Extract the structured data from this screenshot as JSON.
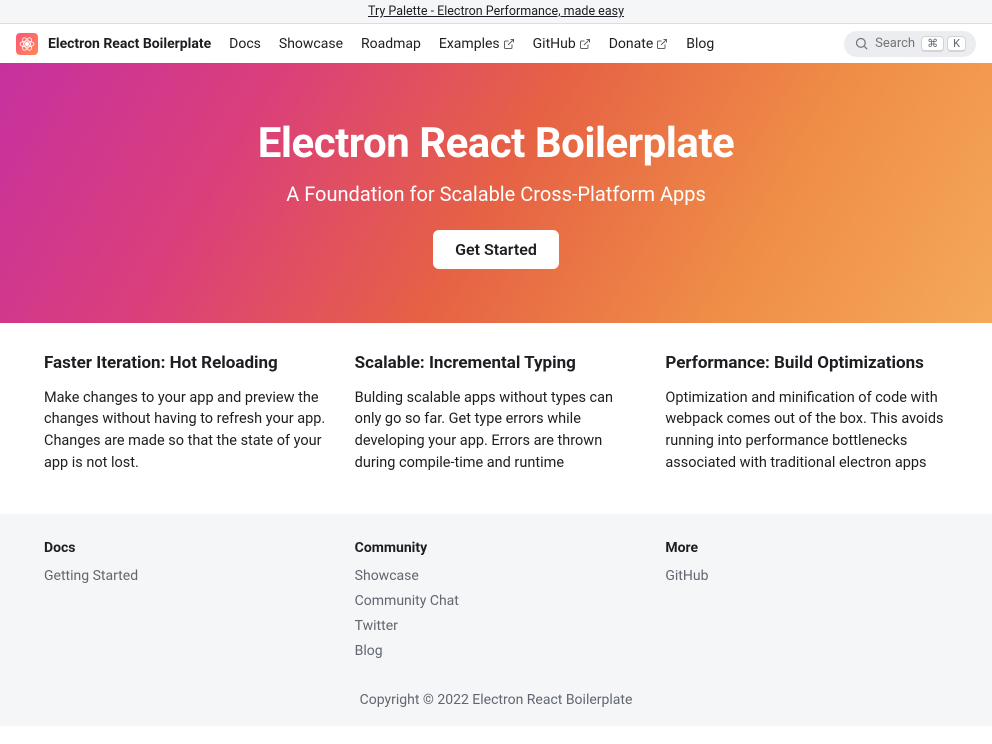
{
  "announcement": {
    "text": "Try Palette - Electron Performance, made easy"
  },
  "navbar": {
    "brand": "Electron React Boilerplate",
    "links": [
      {
        "label": "Docs",
        "external": false
      },
      {
        "label": "Showcase",
        "external": false
      },
      {
        "label": "Roadmap",
        "external": false
      },
      {
        "label": "Examples",
        "external": true
      },
      {
        "label": "GitHub",
        "external": true
      },
      {
        "label": "Donate",
        "external": true
      },
      {
        "label": "Blog",
        "external": false
      }
    ],
    "search": {
      "placeholder": "Search",
      "shortcut": [
        "⌘",
        "K"
      ]
    }
  },
  "hero": {
    "title": "Electron React Boilerplate",
    "subtitle": "A Foundation for Scalable Cross-Platform Apps",
    "cta": "Get Started"
  },
  "features": [
    {
      "title": "Faster Iteration: Hot Reloading",
      "body": "Make changes to your app and preview the changes without having to refresh your app. Changes are made so that the state of your app is not lost."
    },
    {
      "title": "Scalable: Incremental Typing",
      "body": "Bulding scalable apps without types can only go so far. Get type errors while developing your app. Errors are thrown during compile-time and runtime"
    },
    {
      "title": "Performance: Build Optimizations",
      "body": "Optimization and minification of code with webpack comes out of the box. This avoids running into performance bottlenecks associated with traditional electron apps"
    }
  ],
  "footer": {
    "columns": [
      {
        "heading": "Docs",
        "items": [
          "Getting Started"
        ]
      },
      {
        "heading": "Community",
        "items": [
          "Showcase",
          "Community Chat",
          "Twitter",
          "Blog"
        ]
      },
      {
        "heading": "More",
        "items": [
          "GitHub"
        ]
      }
    ],
    "copyright": "Copyright © 2022 Electron React Boilerplate"
  }
}
